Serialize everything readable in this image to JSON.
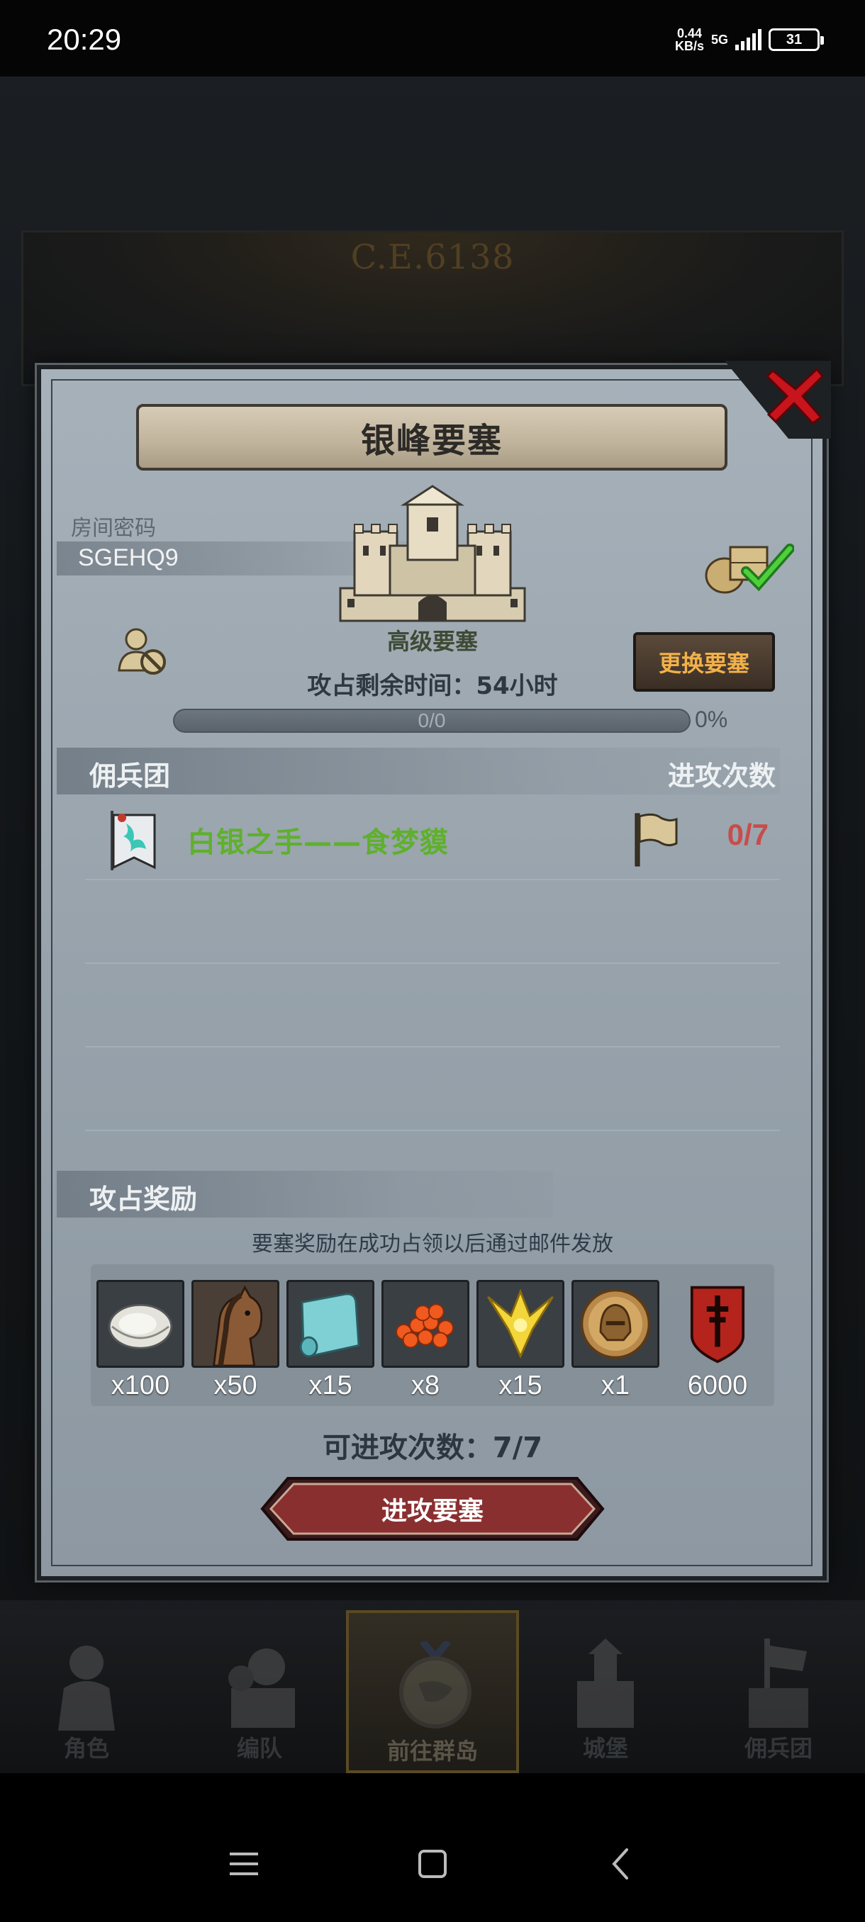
{
  "status_bar": {
    "time": "20:29",
    "net_speed_value": "0.44",
    "net_speed_unit": "KB/s",
    "network": "5G",
    "battery": "31"
  },
  "background": {
    "era": "C.E.6138"
  },
  "modal": {
    "title": "银峰要塞",
    "room_label": "房间密码",
    "room_code": "SGEHQ9",
    "fort_level": "高级要塞",
    "remaining_time_label": "攻占剩余时间：",
    "remaining_time_value": "54小时",
    "change_button": "更换要塞",
    "progress": {
      "text": "0/0",
      "percent_text": "0%",
      "fraction": 0
    },
    "mercenary_header": "佣兵团",
    "attacks_header": "进攻次数",
    "mercenaries": [
      {
        "name": "白银之手——食梦貘",
        "count": "0/7"
      }
    ],
    "rewards_header": "攻占奖励",
    "rewards_note": "要塞奖励在成功占领以后通过邮件发放",
    "rewards": [
      {
        "icon": "oyster-icon",
        "qty": "x100"
      },
      {
        "icon": "horse-icon",
        "qty": "x50"
      },
      {
        "icon": "cloth-roll-icon",
        "qty": "x15"
      },
      {
        "icon": "roe-icon",
        "qty": "x8"
      },
      {
        "icon": "gold-crest-icon",
        "qty": "x15"
      },
      {
        "icon": "helmet-medal-icon",
        "qty": "x1"
      },
      {
        "icon": "banner-shield-icon",
        "qty": "6000"
      }
    ],
    "attempts_label": "可进攻次数：",
    "attempts_value": "7/7",
    "attack_button": "进攻要塞"
  },
  "bottom_nav": [
    {
      "label": "角色",
      "icon": "knight-icon"
    },
    {
      "label": "编队",
      "icon": "squad-icon"
    },
    {
      "label": "前往群岛",
      "icon": "globe-icon",
      "active": true
    },
    {
      "label": "城堡",
      "icon": "castle-icon"
    },
    {
      "label": "佣兵团",
      "icon": "mercenary-icon"
    }
  ],
  "colors": {
    "merc_name": "#5fb02c",
    "merc_count": "#c84c4c",
    "change_button_text": "#f2b14a",
    "close_button": "#c8141c"
  }
}
